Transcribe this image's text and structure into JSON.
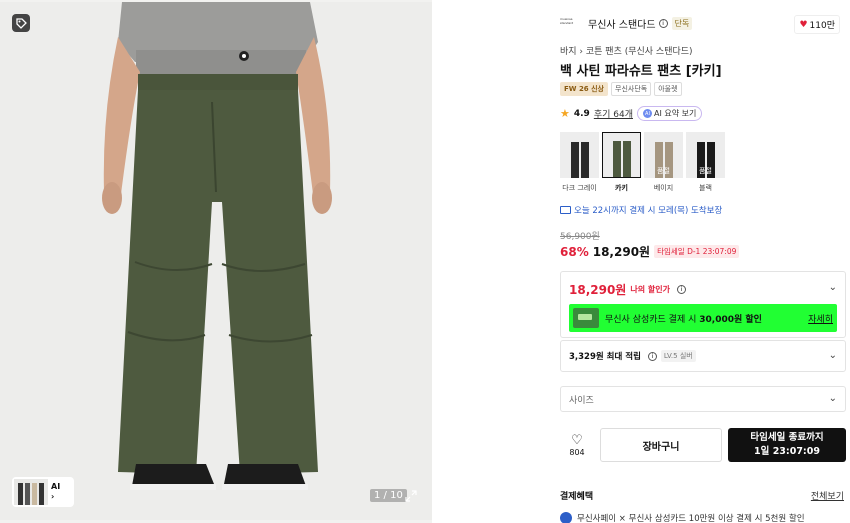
{
  "gallery": {
    "counter": "1 / 10",
    "ai_label": "AI",
    "ai_chevron": "›"
  },
  "brand": {
    "name": "무신사 스탠다드",
    "exclusive": "단독",
    "logo_text": "musinsa standard",
    "likes": "110만"
  },
  "breadcrumb": "바지 › 코튼 팬츠 (무신사 스탠다드)",
  "product": {
    "title": "백 사틴 파라슈트 팬츠 [카키]",
    "badges": [
      "FW 26 신상",
      "무신사단독",
      "아울렛"
    ]
  },
  "rating": {
    "score": "4.9",
    "reviews": "후기 64개",
    "ai_summary": "AI 요약 보기"
  },
  "colors": [
    {
      "label": "다크 그레이",
      "soldout": "",
      "selected": false,
      "leg": "#2a2a2a"
    },
    {
      "label": "카키",
      "soldout": "",
      "selected": true,
      "leg": "#4e5a3f"
    },
    {
      "label": "베이지",
      "soldout": "품절",
      "selected": false,
      "leg": "#a59680"
    },
    {
      "label": "블랙",
      "soldout": "품절",
      "selected": false,
      "leg": "#1a1a1a"
    }
  ],
  "shipping": "오늘 22시까지 결제 시 모레(목) 도착보장",
  "price": {
    "original": "56,900원",
    "discount": "68%",
    "sale": "18,290원",
    "timesale": "타임세일 D-1 23:07:09"
  },
  "my_price": {
    "amount": "18,290원",
    "label": "나의 할인가",
    "card_text_pre": "무신사 삼성카드 결제 시 ",
    "card_text_bold": "30,000원 할인",
    "card_more": "자세히"
  },
  "points": {
    "amount": "3,329원 최대 적립",
    "level": "LV.5 실버"
  },
  "size": {
    "placeholder": "사이즈"
  },
  "actions": {
    "like_count": "804",
    "cart": "장바구니",
    "buy_line1": "타임세일 종료까지",
    "buy_line2": "1일 23:07:09"
  },
  "payment": {
    "heading": "결제혜택",
    "see_all": "전체보기",
    "row_bold": "무신사페이 × 무신사 삼성카드",
    "row_rest": " 10만원 이상 결제 시 5천원 할인"
  },
  "colors_palette": {
    "accent_red": "#e0203a",
    "card_banner": "#21ff33",
    "link_blue": "#2c5ec8",
    "pants_khaki": "#4e5a3f"
  }
}
